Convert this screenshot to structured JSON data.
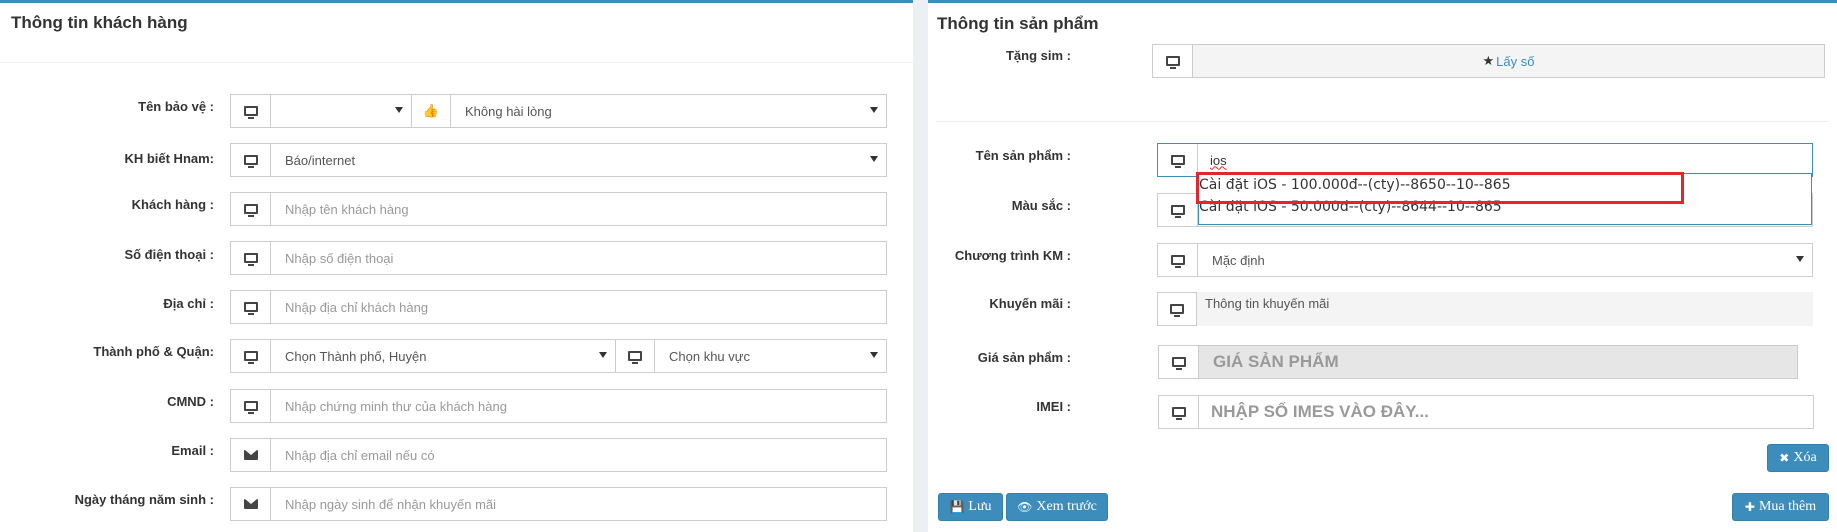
{
  "customer": {
    "title": "Thông tin khách hàng",
    "fields": {
      "ten_bao_ve": {
        "label": "Tên bảo vệ :",
        "value": "",
        "rating": "Không hài lòng"
      },
      "kh_biet": {
        "label": "KH biết Hnam:",
        "value": "Báo/internet"
      },
      "khach_hang": {
        "label": "Khách hàng :",
        "placeholder": "Nhập tên khách hàng"
      },
      "sdt": {
        "label": "Số điện thoại :",
        "placeholder": "Nhập số điện thoại"
      },
      "dia_chi": {
        "label": "Địa chỉ :",
        "placeholder": "Nhập địa chỉ khách hàng"
      },
      "thanh_pho": {
        "label": "Thành phố & Quận:",
        "city": "Chọn Thành phố, Huyện",
        "area": "Chọn khu vực"
      },
      "cmnd": {
        "label": "CMND :",
        "placeholder": "Nhập chứng minh thư của khách hàng"
      },
      "email": {
        "label": "Email :",
        "placeholder": "Nhập địa chỉ email nếu có"
      },
      "ngay_sinh": {
        "label": "Ngày tháng năm sinh :",
        "placeholder": "Nhập ngày sinh để nhận khuyến mãi"
      }
    }
  },
  "product": {
    "title": "Thông tin sản phẩm",
    "tang_sim": {
      "label": "Tặng sim :",
      "button": "Lấy số"
    },
    "ten_sp": {
      "label": "Tên sản phẩm :",
      "value": "ios"
    },
    "mau_sac": {
      "label": "Màu sắc :"
    },
    "ctkm": {
      "label": "Chương trình KM :",
      "value": "Mặc định"
    },
    "khuyen_mai": {
      "label": "Khuyến mãi :",
      "placeholder": "Thông tin khuyến mãi"
    },
    "gia": {
      "label": "Giá sản phẩm :",
      "placeholder": "GIÁ SẢN PHẨM"
    },
    "imei": {
      "label": "IMEI :",
      "placeholder": "NHẬP SỐ IMES VÀO ĐÂY..."
    },
    "suggestions": [
      "Cài đặt iOS - 100.000đ--(cty)--8650--10--865",
      "Cài đặt iOS - 50.000đ--(cty)--8644--10--865"
    ],
    "buttons": {
      "xoa": "Xóa",
      "luu": "Lưu",
      "xem_truoc": "Xem trước",
      "mua_them": "Mua thêm"
    }
  },
  "colors": {
    "accent": "#3c8dbc",
    "highlight": "#e4252c"
  }
}
